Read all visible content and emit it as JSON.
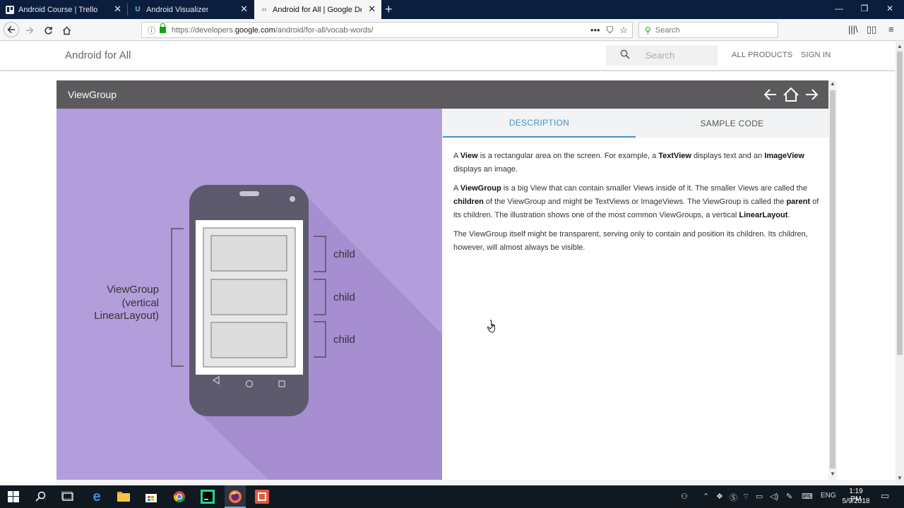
{
  "browser": {
    "tabs": [
      {
        "title": "Android Course | Trello",
        "close": "✕"
      },
      {
        "title": "Android Visualizer",
        "close": "✕"
      },
      {
        "title": "Android for All  |  Google Developers",
        "close": "✕"
      }
    ],
    "new_tab": "+",
    "window_controls": {
      "minimize": "—",
      "maximize": "❐",
      "close": "✕"
    },
    "url_prefix": "https://developers.",
    "url_domain": "google.com",
    "url_path": "/android/for-all/vocab-words/",
    "search_placeholder": "Search"
  },
  "site": {
    "title": "Android for All",
    "search_placeholder": "Search",
    "all_products": "ALL PRODUCTS",
    "sign_in": "SIGN IN"
  },
  "widget": {
    "title": "ViewGroup",
    "tabs": {
      "description": "DESCRIPTION",
      "sample_code": "SAMPLE CODE"
    },
    "illustration": {
      "group_label_lines": [
        "ViewGroup",
        "(vertical",
        "LinearLayout)"
      ],
      "child_labels": [
        "child",
        "child",
        "child"
      ]
    },
    "description": {
      "p1": {
        "t1": "A ",
        "b1": "View",
        "t2": " is a rectangular area on the screen. For example, a ",
        "b2": "TextView",
        "t3": " displays text and an ",
        "b3": "ImageView",
        "t4": " displays an image."
      },
      "p2": {
        "t1": "A ",
        "b1": "ViewGroup",
        "t2": " is a big View that can contain smaller Views inside of it. The smaller Views are called the ",
        "b2": "children",
        "t3": " of the ViewGroup and might be TextViews or ImageViews. The ViewGroup is called the ",
        "b3": "parent",
        "t4": " of its children. The illustration shows one of the most common ViewGroups, a vertical ",
        "b4": "LinearLayout",
        "t5": "."
      },
      "p3": "The ViewGroup itself might be transparent, serving only to contain and position its children. Its children, however, will almost always be visible."
    }
  },
  "taskbar": {
    "language": "ENG",
    "time": "1:19 PM",
    "date": "5/9/2018"
  },
  "colors": {
    "illustration_bg": "#b39ddb",
    "phone_body": "#5d5a6e",
    "accent": "#4a8fc7",
    "widget_header": "#5d5a5e"
  }
}
